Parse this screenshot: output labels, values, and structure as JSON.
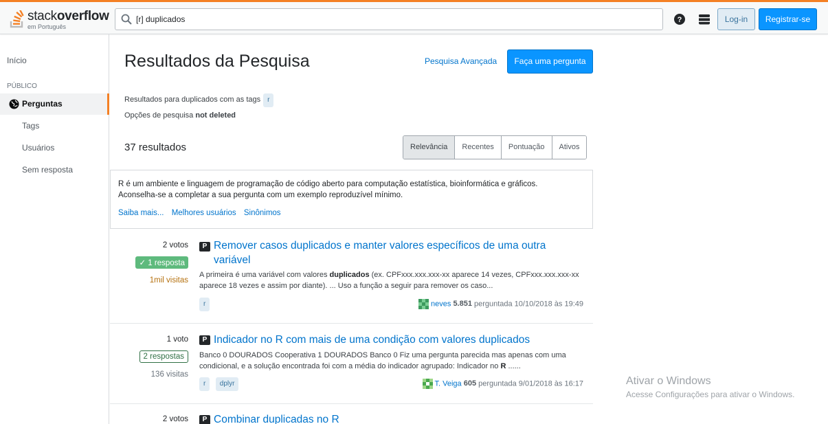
{
  "header": {
    "logo_word": "stack",
    "logo_word_bold": "overflow",
    "logo_sub": "em Português",
    "search_value": "[r] duplicados",
    "login_label": "Log-in",
    "register_label": "Registrar-se"
  },
  "sidebar": {
    "inicio": "Início",
    "section": "PÚBLICO",
    "perguntas": "Perguntas",
    "tags": "Tags",
    "usuarios": "Usuários",
    "sem_resposta": "Sem resposta"
  },
  "main": {
    "title": "Resultados da Pesquisa",
    "advanced": "Pesquisa Avançada",
    "ask": "Faça uma pergunta",
    "results_for": "Resultados para duplicados com as tags",
    "results_tag": "r",
    "options_label": "Opções de pesquisa",
    "options_value": "not deleted",
    "count": "37 resultados",
    "filters": [
      "Relevância",
      "Recentes",
      "Pontuação",
      "Ativos"
    ]
  },
  "tagwiki": {
    "line1": "R é um ambiente e linguagem de programação de código aberto para computação estatística, bioinformática e gráficos.",
    "line2": "Aconselha-se a completar a sua pergunta com um exemplo reproduzível mínimo.",
    "link1": "Saiba mais...",
    "link2": "Melhores usuários",
    "link3": "Sinônimos"
  },
  "questions": [
    {
      "votes": "2 votos",
      "answers": "✓ 1 resposta",
      "views": "1mil visitas",
      "icon": "P",
      "title": "Remover casos duplicados e manter valores específicos de uma outra variável",
      "ex_a": "A primeira é uma variável com valores ",
      "ex_b": "duplicados",
      "ex_c": " (ex. CPFxxx.xxx.xxx-xx aparece 14 vezes, CPFxxx.xxx.xxx-xx aparece 18 vezes e assim por diante). ... Uso a função a seguir para remover os caso...",
      "tags": [
        "r"
      ],
      "user": "neves",
      "rep": "5.851",
      "asked": "perguntada 10/10/2018 às 19:49"
    },
    {
      "votes": "1 voto",
      "answers": "2 respostas",
      "views": "136 visitas",
      "icon": "P",
      "title": "Indicador no R com mais de uma condição com valores duplicados",
      "ex_a": "Banco 0 DOURADOS Cooperativa 1 DOURADOS Banco 0 Fiz uma pergunta parecida mas apenas com uma condicional, e a solução encontrada foi com a média do indicador agrupado: Indicador no ",
      "ex_b": "R",
      "ex_c": " ......",
      "tags": [
        "r",
        "dplyr"
      ],
      "user": "T. Veiga",
      "rep": "605",
      "asked": "perguntada 9/01/2018 às 16:17"
    },
    {
      "votes": "2 votos",
      "icon": "P",
      "title": "Combinar duplicadas no R"
    }
  ],
  "watermark": {
    "line1": "Ativar o Windows",
    "line2": "Acesse Configurações para ativar o Windows."
  },
  "colors": {
    "accent": "#f48024",
    "link": "#0074cc",
    "primary_button": "#0a95ff",
    "accepted": "#5eba7d"
  }
}
